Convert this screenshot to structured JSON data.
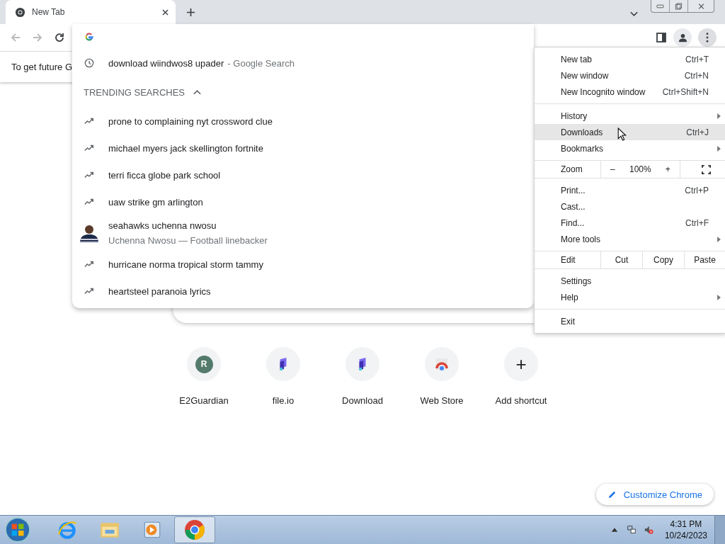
{
  "tab": {
    "title": "New Tab",
    "selected": true
  },
  "infobar": {
    "text": "To get future G"
  },
  "dropdown": {
    "history": {
      "text": "download wiindwos8 upader",
      "suffix": "- Google Search"
    },
    "trending": {
      "heading": "TRENDING SEARCHES",
      "expanded": true,
      "items": [
        {
          "kind": "trend",
          "text": "prone to complaining nyt crossword clue"
        },
        {
          "kind": "trend",
          "text": "michael myers jack skellington fortnite"
        },
        {
          "kind": "trend",
          "text": "terri ficca globe park school"
        },
        {
          "kind": "trend",
          "text": "uaw strike gm arlington"
        },
        {
          "kind": "entity",
          "text": "seahawks uchenna nwosu",
          "detail": "Uchenna Nwosu — Football linebacker"
        },
        {
          "kind": "trend",
          "text": "hurricane norma tropical storm tammy"
        },
        {
          "kind": "trend",
          "text": "heartsteel paranoia lyrics"
        }
      ]
    }
  },
  "menu": {
    "sections": [
      [
        {
          "kind": "item",
          "label": "New tab",
          "shortcut": "Ctrl+T",
          "submenu": false,
          "selected": false
        },
        {
          "kind": "item",
          "label": "New window",
          "shortcut": "Ctrl+N",
          "submenu": false,
          "selected": false
        },
        {
          "kind": "item",
          "label": "New Incognito window",
          "shortcut": "Ctrl+Shift+N",
          "submenu": false,
          "selected": false
        }
      ],
      [
        {
          "kind": "item",
          "label": "History",
          "submenu": true,
          "selected": false
        },
        {
          "kind": "item",
          "label": "Downloads",
          "shortcut": "Ctrl+J",
          "submenu": false,
          "selected": true
        },
        {
          "kind": "item",
          "label": "Bookmarks",
          "submenu": true,
          "selected": false
        }
      ],
      [
        {
          "kind": "zoom",
          "label": "Zoom",
          "minus": "–",
          "value": "100%",
          "plus": "+"
        }
      ],
      [
        {
          "kind": "item",
          "label": "Print...",
          "shortcut": "Ctrl+P",
          "submenu": false,
          "selected": false
        },
        {
          "kind": "item",
          "label": "Cast...",
          "submenu": false,
          "selected": false
        },
        {
          "kind": "item",
          "label": "Find...",
          "shortcut": "Ctrl+F",
          "submenu": false,
          "selected": false
        },
        {
          "kind": "item",
          "label": "More tools",
          "submenu": true,
          "selected": false
        }
      ],
      [
        {
          "kind": "edit",
          "label": "Edit",
          "buttons": [
            "Cut",
            "Copy",
            "Paste"
          ]
        }
      ],
      [
        {
          "kind": "item",
          "label": "Settings",
          "submenu": false,
          "selected": false
        },
        {
          "kind": "item",
          "label": "Help",
          "submenu": true,
          "selected": false
        }
      ],
      [
        {
          "kind": "item",
          "label": "Exit",
          "submenu": false,
          "selected": false
        }
      ]
    ]
  },
  "shortcuts": [
    {
      "kind": "letter",
      "letter": "R",
      "label": "E2Guardian"
    },
    {
      "kind": "site",
      "label": "file.io"
    },
    {
      "kind": "site",
      "label": "Download"
    },
    {
      "kind": "store",
      "label": "Web Store"
    },
    {
      "kind": "add",
      "glyph": "+",
      "label": "Add shortcut"
    }
  ],
  "customize": {
    "label": "Customize Chrome"
  },
  "taskbar": {
    "apps": [
      {
        "kind": "ie",
        "selected": false
      },
      {
        "kind": "explorer",
        "selected": false
      },
      {
        "kind": "media",
        "selected": false
      },
      {
        "kind": "chrome",
        "selected": true
      }
    ],
    "time": "4:31 PM",
    "date": "10/24/2023"
  }
}
